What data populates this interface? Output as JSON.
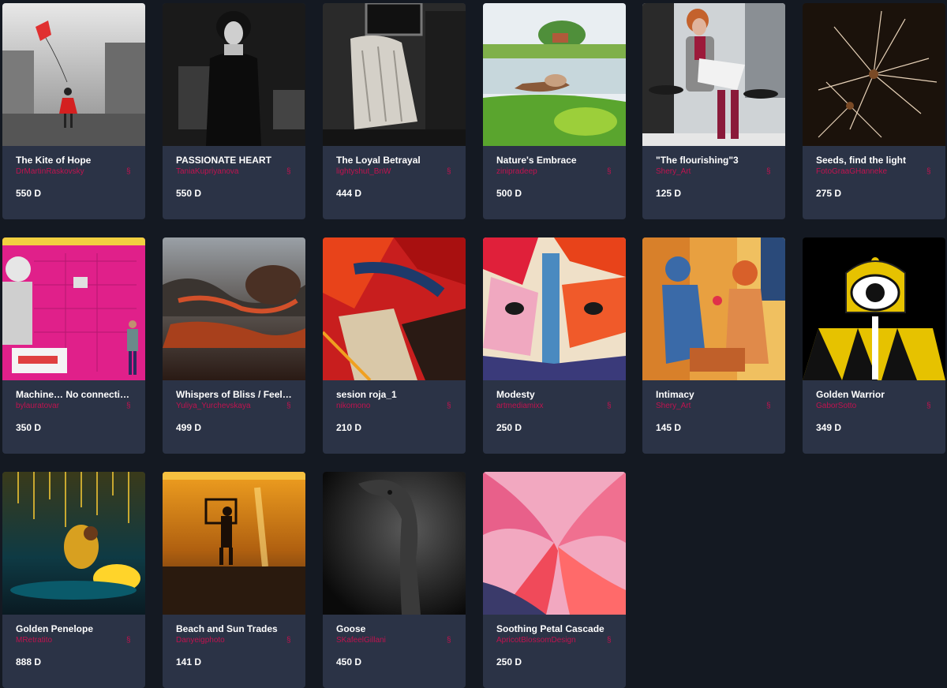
{
  "gallery": {
    "cards": [
      {
        "title": "The Kite of Hope",
        "artist": "DrMartinRaskovsky",
        "price": "550 D",
        "mark": "§"
      },
      {
        "title": "PASSIONATE HEART",
        "artist": "TaniaKupriyanova",
        "price": "550 D",
        "mark": "§"
      },
      {
        "title": "The Loyal Betrayal",
        "artist": "lightyshut_BnW",
        "price": "444 D",
        "mark": "§"
      },
      {
        "title": "Nature's Embrace",
        "artist": "zinipradeep",
        "price": "500 D",
        "mark": "§"
      },
      {
        "title": "\"The flourishing\"3",
        "artist": "Shery_Art",
        "price": "125 D",
        "mark": "§"
      },
      {
        "title": "Seeds, find the light",
        "artist": "FotoGraaGHanneke",
        "price": "275 D",
        "mark": "§"
      },
      {
        "title": "Machine… No connection…",
        "artist": "bylauratovar",
        "price": "350 D",
        "mark": "§"
      },
      {
        "title": "Whispers of Bliss / Feelin…",
        "artist": "Yuliya_Yurchevskaya",
        "price": "499 D",
        "mark": "§"
      },
      {
        "title": "sesion roja_1",
        "artist": "nikomono",
        "price": "210 D",
        "mark": "§"
      },
      {
        "title": "Modesty",
        "artist": "artmediamixx",
        "price": "250 D",
        "mark": "§"
      },
      {
        "title": "Intimacy",
        "artist": "Shery_Art",
        "price": "145 D",
        "mark": "§"
      },
      {
        "title": "Golden Warrior",
        "artist": "GaborSotto",
        "price": "349 D",
        "mark": "§"
      },
      {
        "title": "Golden Penelope",
        "artist": "MRetratito",
        "price": "888 D",
        "mark": "§"
      },
      {
        "title": "Beach and Sun Trades",
        "artist": "Danyeigphoto",
        "price": "141 D",
        "mark": "§"
      },
      {
        "title": "Goose",
        "artist": "SKafeelGillani",
        "price": "450 D",
        "mark": "§"
      },
      {
        "title": "Soothing Petal Cascade",
        "artist": "ApricotBlossomDesign",
        "price": "250 D",
        "mark": "§"
      }
    ]
  },
  "colors": {
    "background": "#141922",
    "card": "#2b3346",
    "accent": "#c0134f",
    "text": "#ffffff"
  }
}
